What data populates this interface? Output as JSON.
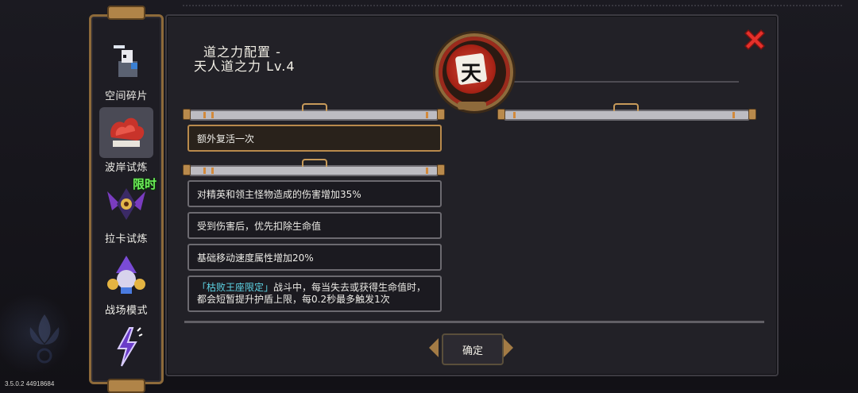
{
  "sidebar": {
    "items": [
      {
        "label": "空间碎片",
        "icon": "space-fragment-icon"
      },
      {
        "label": "波岸试炼",
        "icon": "coral-trial-icon",
        "selected": true
      },
      {
        "label": "拉卡试炼",
        "icon": "laka-trial-icon",
        "badge": "限时"
      },
      {
        "label": "战场模式",
        "icon": "battlefield-icon"
      },
      {
        "label": "",
        "icon": "lightning-icon"
      }
    ]
  },
  "panel": {
    "title_line1": "道之力配置 -",
    "title_line2": "天人道之力 Lv.4",
    "emblem_char": "天",
    "close_icon": "close-icon"
  },
  "upper_list": {
    "items": [
      "额外复活一次"
    ]
  },
  "lower_list": {
    "items": [
      "对精英和领主怪物造成的伤害增加35%",
      "受到伤害后，优先扣除生命值",
      "基础移动速度属性增加20%"
    ],
    "long_item": {
      "highlight": "「枯败王座限定」",
      "text": "战斗中，每当失去或获得生命值时，都会短暂提升护盾上限，每0.2秒最多触发1次"
    }
  },
  "confirm_label": "确定",
  "version": "3.5.0.2 44918684",
  "colors": {
    "accent_gold": "#b98a4c",
    "highlight": "#5ed5e6",
    "close_red": "#e5302a"
  }
}
